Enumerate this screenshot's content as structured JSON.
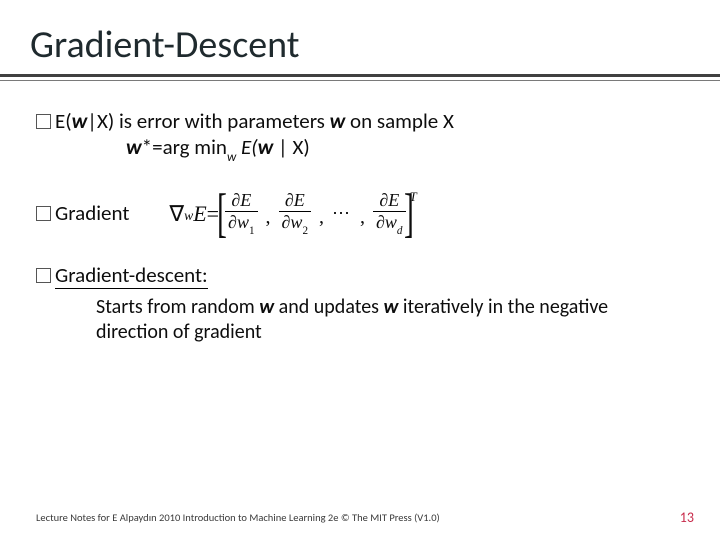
{
  "title": "Gradient-Descent",
  "line1_prefix": "E(",
  "line1_w": "w",
  "line1_mid": "|X) is error with parameters ",
  "line1_w2": "w",
  "line1_suffix": " on sample X",
  "line2_w": "w",
  "line2_star": "*=arg min",
  "line2_sub": "w",
  "line2_E": " E(",
  "line2_w3": "w",
  "line2_end": " | X)",
  "gradient_label": "Gradient",
  "eq_lhs1": "∇",
  "eq_lhs_sub": "w",
  "eq_lhs_E": "E",
  "eq_equals": " = ",
  "eq_dE": "∂E",
  "eq_dw": "∂w",
  "eq_s1": "1",
  "eq_s2": "2",
  "eq_sd": "d",
  "eq_dots": "⋯",
  "eq_T": "T",
  "gd_label": "Gradient-descent:",
  "gd_text_a": "Starts from random ",
  "gd_text_b": "w",
  "gd_text_c": " and updates ",
  "gd_text_d": "w",
  "gd_text_e": " iteratively in the negative direction of gradient",
  "footer": "Lecture Notes for E Alpaydın 2010 Introduction to Machine Learning 2e © The MIT Press (V1.0)",
  "page": "13"
}
